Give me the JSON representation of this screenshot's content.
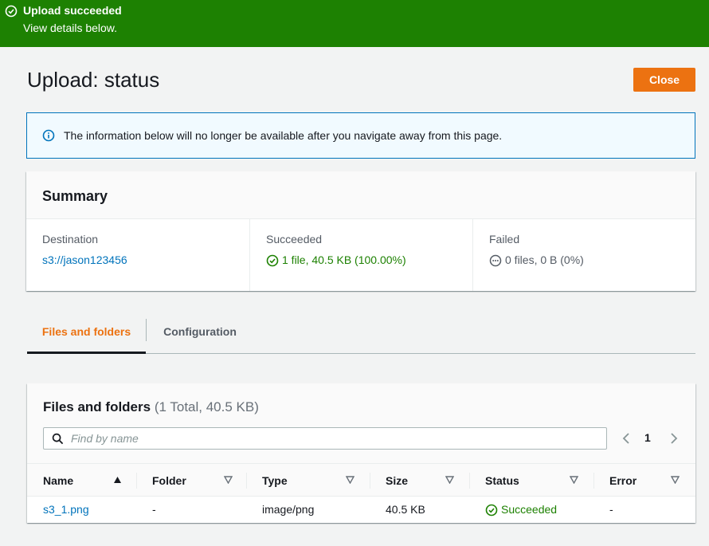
{
  "flash": {
    "title": "Upload succeeded",
    "subtitle": "View details below.",
    "icon": "check-circle-icon",
    "color": "#1d8102"
  },
  "header": {
    "title": "Upload: status",
    "close_label": "Close",
    "accent": "#ec7211"
  },
  "info_alert": {
    "icon": "info-icon",
    "text": "The information below will no longer be available after you navigate away from this page."
  },
  "summary": {
    "title": "Summary",
    "destination": {
      "label": "Destination",
      "value": "s3://jason123456"
    },
    "succeeded": {
      "label": "Succeeded",
      "value": "1 file, 40.5 KB (100.00%)",
      "icon": "check-circle-icon"
    },
    "failed": {
      "label": "Failed",
      "value": "0 files, 0 B (0%)",
      "icon": "ellipsis-circle-icon"
    }
  },
  "tabs": [
    {
      "label": "Files and folders",
      "active": true
    },
    {
      "label": "Configuration",
      "active": false
    }
  ],
  "files": {
    "title": "Files and folders",
    "count": "(1 Total, 40.5 KB)",
    "search_placeholder": "Find by name",
    "page": "1",
    "columns": [
      "Name",
      "Folder",
      "Type",
      "Size",
      "Status",
      "Error"
    ],
    "rows": [
      {
        "name": "s3_1.png",
        "folder": "-",
        "type": "image/png",
        "size": "40.5 KB",
        "status": "Succeeded",
        "error": "-"
      }
    ]
  }
}
